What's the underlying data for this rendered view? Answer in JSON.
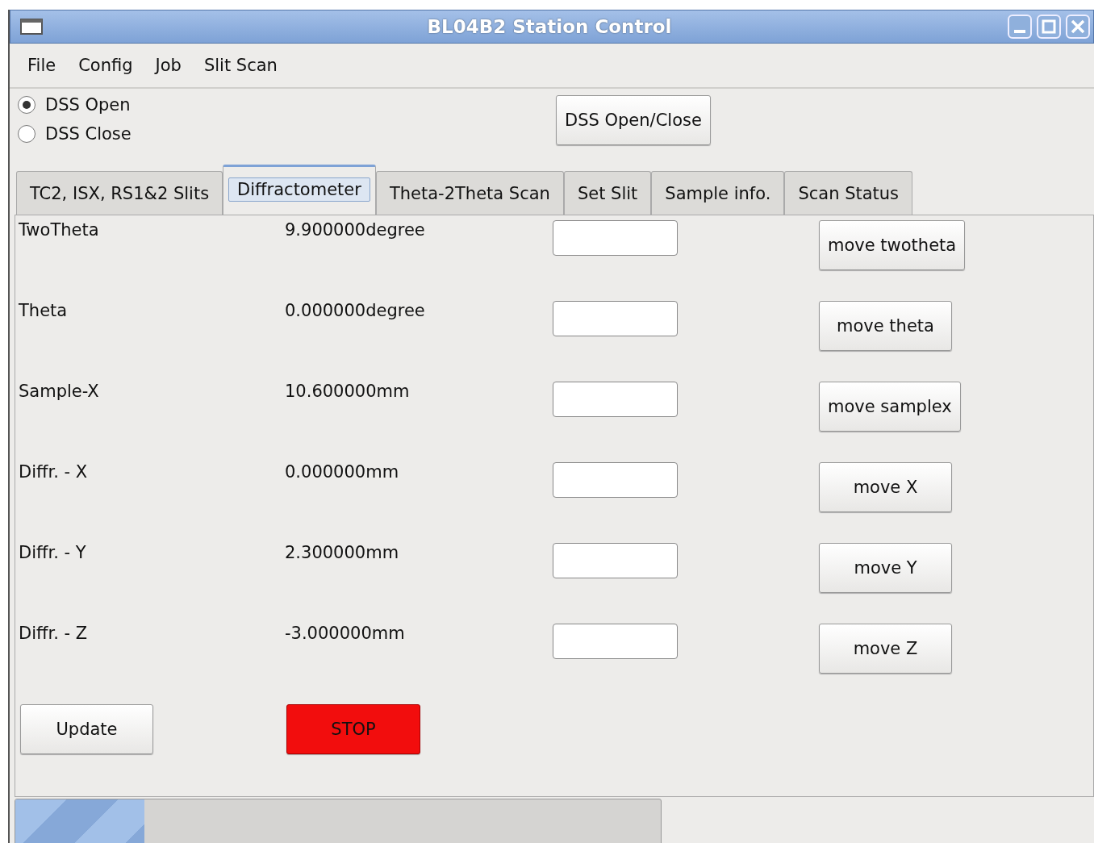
{
  "window": {
    "title": "BL04B2 Station Control"
  },
  "menu": [
    "File",
    "Config",
    "Job",
    "Slit Scan"
  ],
  "dss_options": [
    {
      "label": "DSS Open",
      "selected": true
    },
    {
      "label": "DSS Close",
      "selected": false
    }
  ],
  "dss_button": "DSS Open/Close",
  "tabs": [
    {
      "label": "TC2, ISX, RS1&2 Slits",
      "selected": false
    },
    {
      "label": "Diffractometer",
      "selected": true
    },
    {
      "label": "Theta-2Theta Scan",
      "selected": false
    },
    {
      "label": "Set Slit",
      "selected": false
    },
    {
      "label": "Sample info.",
      "selected": false
    },
    {
      "label": "Scan Status",
      "selected": false
    }
  ],
  "axes": [
    {
      "name": "TwoTheta",
      "value": "9.900000degree",
      "button": "move twotheta"
    },
    {
      "name": "Theta",
      "value": "0.000000degree",
      "button": "move theta"
    },
    {
      "name": "Sample-X",
      "value": "10.600000mm",
      "button": "move samplex"
    },
    {
      "name": "Diffr. - X",
      "value": "0.000000mm",
      "button": "move X"
    },
    {
      "name": "Diffr. - Y",
      "value": "2.300000mm",
      "button": "move Y"
    },
    {
      "name": "Diffr. - Z",
      "value": "-3.000000mm",
      "button": "move Z"
    }
  ],
  "update_button": "Update",
  "stop_button": "STOP",
  "progress": {
    "level": 0.2
  }
}
